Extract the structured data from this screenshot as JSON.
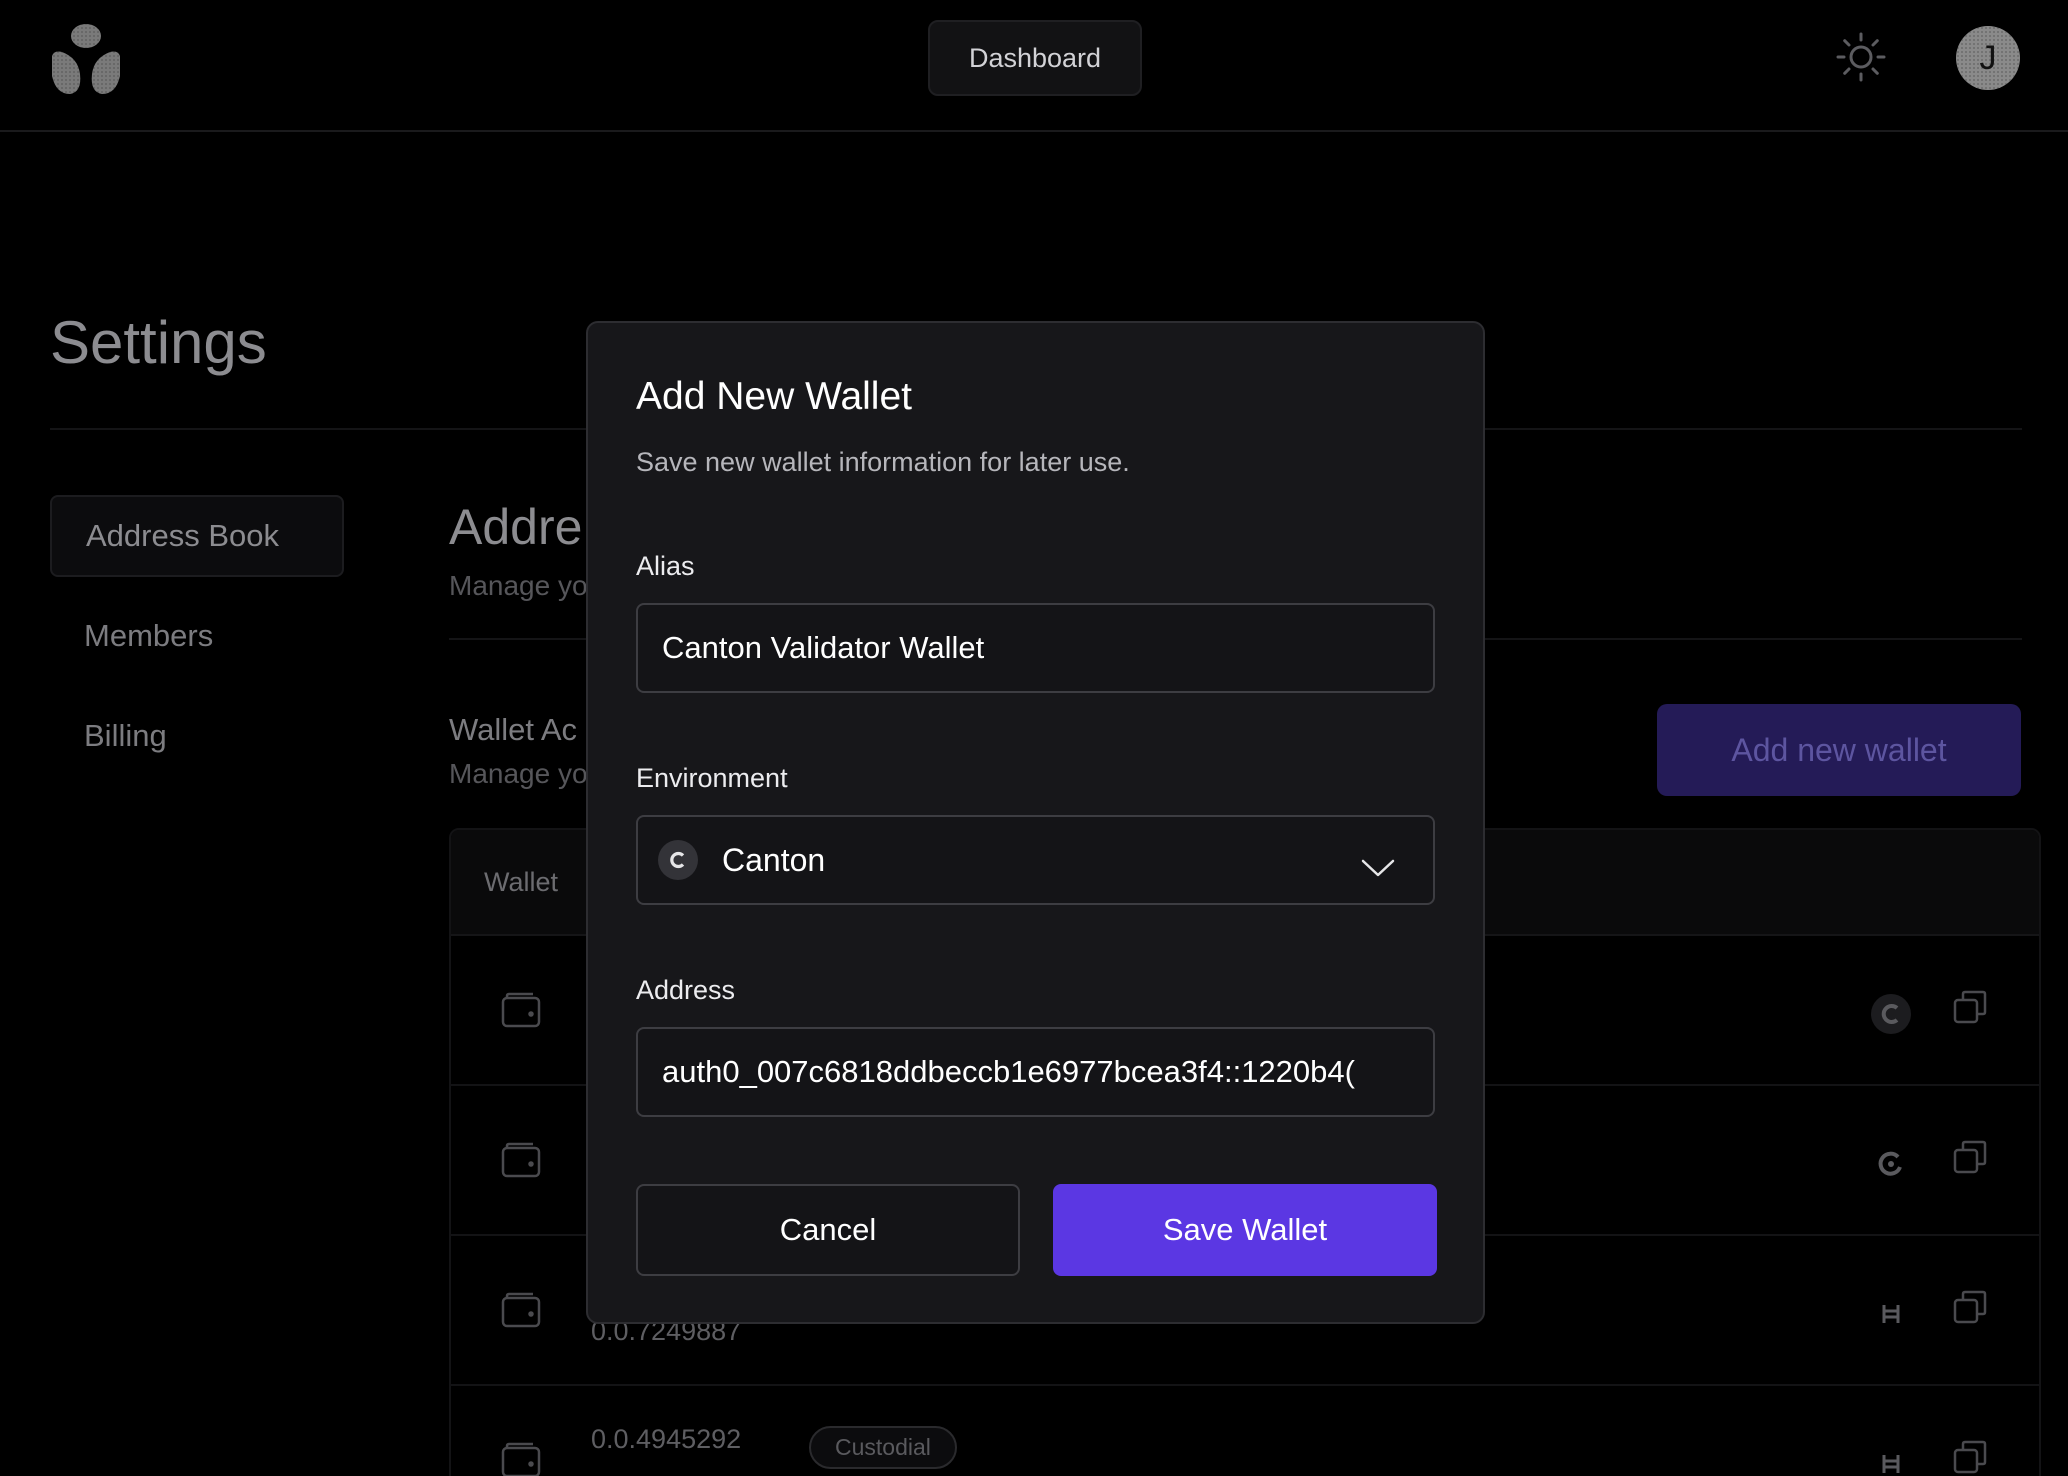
{
  "header": {
    "dashboard_label": "Dashboard",
    "avatar_initial": "J"
  },
  "settings": {
    "title": "Settings",
    "sidebar": [
      {
        "label": "Address Book",
        "active": true
      },
      {
        "label": "Members",
        "active": false
      },
      {
        "label": "Billing",
        "active": false
      }
    ],
    "section_title": "Addre",
    "section_subtitle": "Manage yo",
    "wallet_title": "Wallet Ac",
    "wallet_subtitle": "Manage yo",
    "add_wallet_label": "Add new wallet",
    "table": {
      "header_wallet": "Wallet",
      "rows": [
        {
          "address": "",
          "badge": "",
          "chain_icon": "canton-icon"
        },
        {
          "address": "",
          "badge": "",
          "chain_icon": "spiral-icon"
        },
        {
          "address": "0.0.7249887",
          "badge": "",
          "chain_icon": "hedera-icon"
        },
        {
          "address": "0.0.4945292",
          "badge": "Custodial",
          "chain_icon": "hedera-icon"
        }
      ]
    }
  },
  "modal": {
    "title": "Add New Wallet",
    "description": "Save new wallet information for later use.",
    "alias_label": "Alias",
    "alias_value": "Canton Validator Wallet",
    "environment_label": "Environment",
    "environment_value": "Canton",
    "environment_icon": "canton-icon",
    "address_label": "Address",
    "address_value": "auth0_007c6818ddbeccb1e6977bcea3f4::1220b4(",
    "cancel_label": "Cancel",
    "save_label": "Save Wallet"
  },
  "colors": {
    "accent": "#5b37e3",
    "accent_dimmed": "#241b57",
    "modal_bg": "#17171a",
    "page_bg": "#000000"
  }
}
